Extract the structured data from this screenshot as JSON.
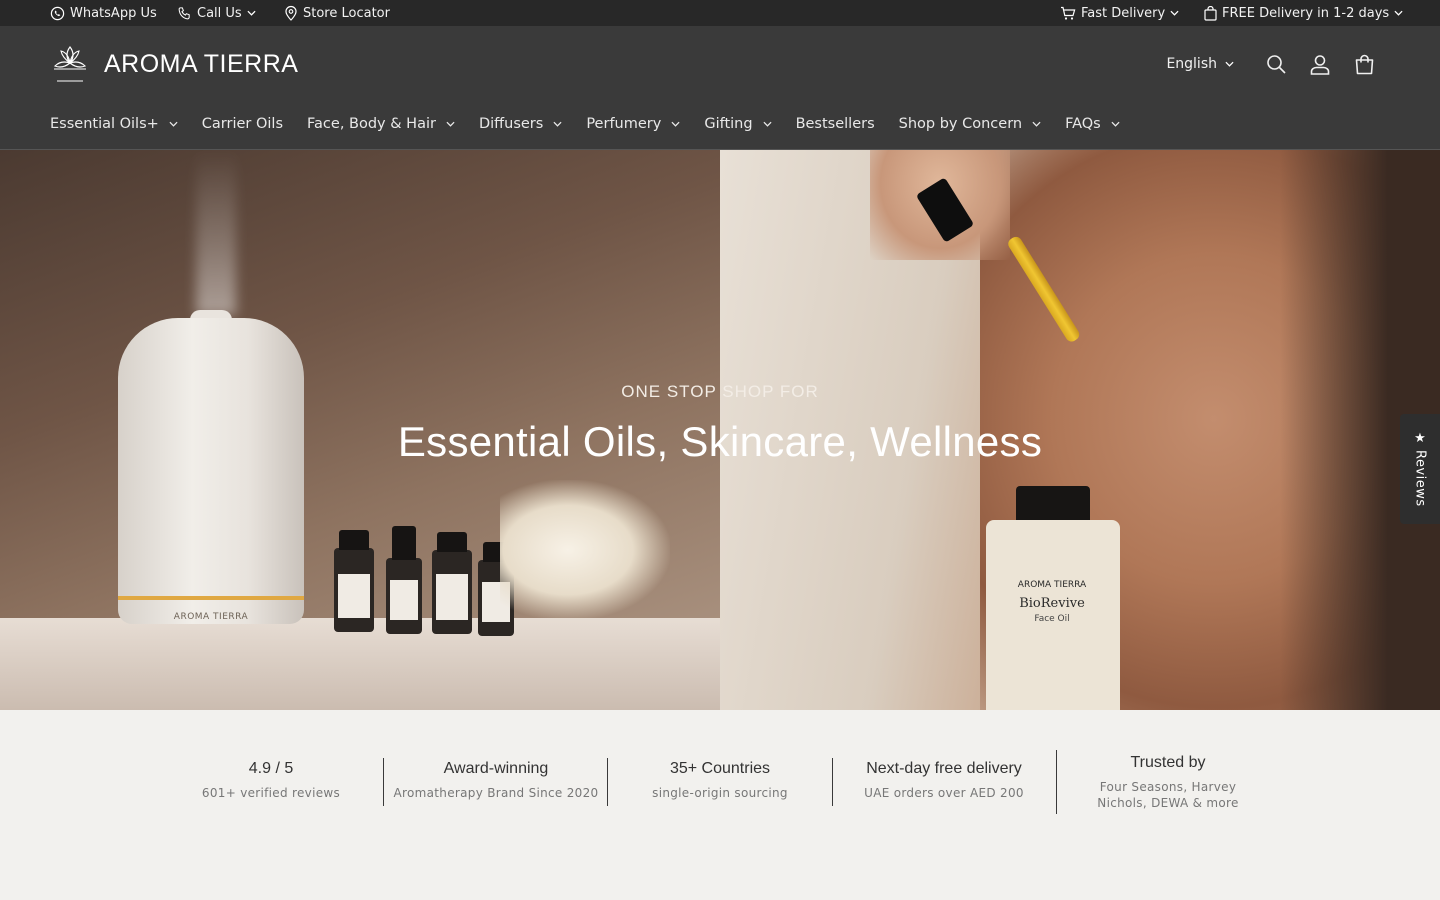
{
  "topbar": {
    "whatsapp": "WhatsApp Us",
    "call": "Call Us",
    "store": "Store Locator",
    "fast_delivery": "Fast Delivery",
    "free_delivery": "FREE Delivery in 1-2 days"
  },
  "header": {
    "logo_small": "AROMA TIERRA",
    "brand": "AROMA TIERRA",
    "language": "English"
  },
  "nav": [
    {
      "label": "Essential Oils+",
      "dropdown": true
    },
    {
      "label": "Carrier Oils",
      "dropdown": false
    },
    {
      "label": "Face, Body & Hair",
      "dropdown": true
    },
    {
      "label": "Diffusers",
      "dropdown": true
    },
    {
      "label": "Perfumery",
      "dropdown": true
    },
    {
      "label": "Gifting",
      "dropdown": true
    },
    {
      "label": "Bestsellers",
      "dropdown": false
    },
    {
      "label": "Shop by Concern",
      "dropdown": true
    },
    {
      "label": "FAQs",
      "dropdown": true
    }
  ],
  "hero": {
    "kicker": "ONE STOP SHOP FOR",
    "title": "Essential Oils, Skincare, Wellness",
    "diffuser_label": "AROMA TIERRA",
    "serum_brand": "AROMA TIERRA",
    "serum_name": "BioRevive",
    "serum_sub": "Face Oil"
  },
  "reviews_tab": {
    "star": "★",
    "label": "Reviews"
  },
  "trust": [
    {
      "title": "4.9 / 5",
      "sub": "601+ verified reviews"
    },
    {
      "title": "Award-winning",
      "sub": "Aromatherapy Brand Since 2020"
    },
    {
      "title": "35+ Countries",
      "sub": "single-origin sourcing"
    },
    {
      "title": "Next-day free delivery",
      "sub": "UAE orders over AED 200"
    },
    {
      "title": "Trusted by",
      "sub": "Four Seasons, Harvey Nichols, DEWA & more"
    }
  ],
  "colors": {
    "topbar": "#282828",
    "header": "#3a3a3a",
    "page_bg": "#f2f1ee",
    "accent_gold": "#e0a842"
  }
}
